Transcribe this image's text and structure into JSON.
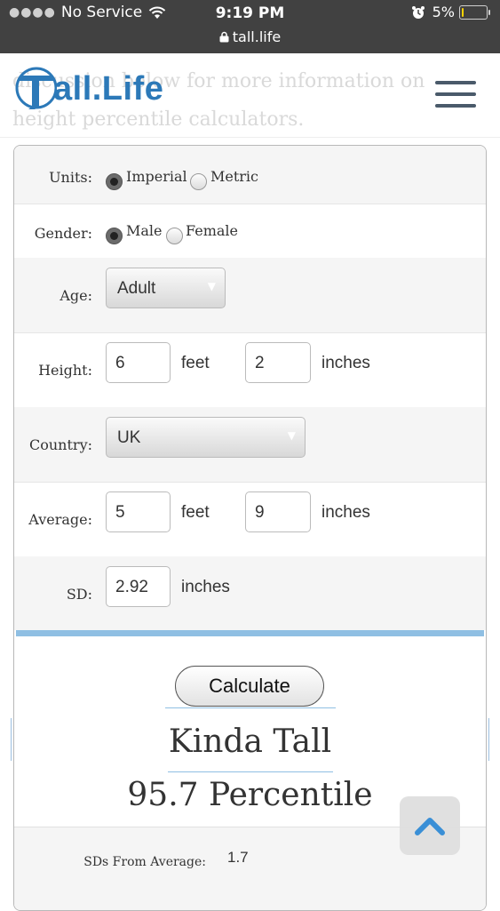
{
  "status_bar": {
    "carrier": "No Service",
    "time": "9:19 PM",
    "battery": "5%",
    "url": "tall.life"
  },
  "header": {
    "background_text": "discussion below for more information on height percentile calculators.",
    "logo_text": "all.Life"
  },
  "form": {
    "units": {
      "label": "Units:",
      "options": [
        "Imperial",
        "Metric"
      ],
      "selected": "Imperial"
    },
    "gender": {
      "label": "Gender:",
      "options": [
        "Male",
        "Female"
      ],
      "selected": "Male"
    },
    "age": {
      "label": "Age:",
      "value": "Adult"
    },
    "height": {
      "label": "Height:",
      "feet": "6",
      "feet_unit": "feet",
      "inches": "2",
      "inches_unit": "inches"
    },
    "country": {
      "label": "Country:",
      "value": "UK"
    },
    "average": {
      "label": "Average:",
      "feet": "5",
      "feet_unit": "feet",
      "inches": "9",
      "inches_unit": "inches"
    },
    "sd": {
      "label": "SD:",
      "value": "2.92",
      "unit": "inches"
    }
  },
  "calculate_label": "Calculate",
  "result": {
    "title": "Kinda Tall",
    "percentile": "95.7 Percentile",
    "sds_label": "SDs From Average:",
    "sds_value": "1.7"
  },
  "colors": {
    "brand_blue": "#2c79b8",
    "accent_line": "#8fbfe3",
    "status_bar": "#414141"
  }
}
